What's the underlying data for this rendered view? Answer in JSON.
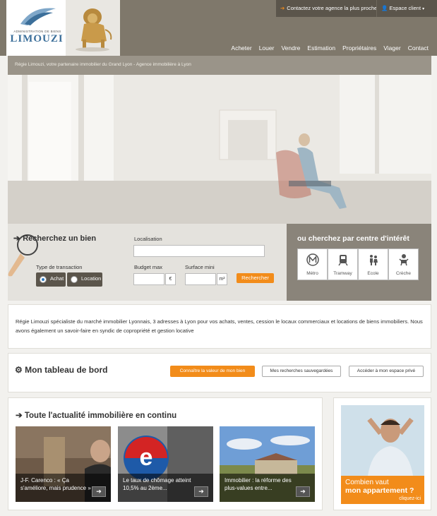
{
  "colors": {
    "accent": "#f28c1a",
    "header": "#7f786b",
    "brand_blue": "#3c6f9a"
  },
  "logo": {
    "subtitle": "ADMINISTRATION DE BIENS",
    "name": "LIMOUZI"
  },
  "topbar": {
    "contact": "Contactez votre agence la plus proche",
    "client": "Espace client"
  },
  "nav": [
    "Acheter",
    "Louer",
    "Vendre",
    "Estimation",
    "Propriétaires",
    "Viager",
    "Contact"
  ],
  "tagline": "Régie Limouzi, votre partenaire immobilier du Grand Lyon - Agence immobilière à Lyon",
  "search": {
    "title": "Recherchez un bien",
    "localisation_label": "Localisation",
    "localisation_value": "",
    "transaction_label": "Type de transaction",
    "achat": "Achat",
    "location": "Location",
    "budget_label": "Budget max",
    "budget_unit": "€",
    "surface_label": "Surface mini",
    "surface_unit": "m²",
    "submit": "Rechercher"
  },
  "poi": {
    "title": "ou cherchez par centre d'intérêt",
    "items": [
      {
        "label": "Métro",
        "icon": "metro-icon"
      },
      {
        "label": "Tramway",
        "icon": "tram-icon"
      },
      {
        "label": "Ecole",
        "icon": "school-icon"
      },
      {
        "label": "Crèche",
        "icon": "nursery-icon"
      }
    ]
  },
  "description": "Régie Limouzi spécialiste du marché immobilier Lyonnais, 3 adresses à Lyon pour vos achats, ventes, cession le locaux commerciaux et locations de biens immobiliers. Nous avons également un savoir-faire en syndic de copropriété et gestion locative",
  "dashboard": {
    "title": "Mon tableau de bord",
    "btn_value": "Connaître la valeur de mon bien",
    "btn_saved": "Mes recherches sauvegardées",
    "btn_private": "Accéder à mon espace privé"
  },
  "news": {
    "title": "Toute l'actualité immobilière en continu",
    "items": [
      {
        "caption": "J-F. Carenco : « Ça s'améliore, mais prudence »"
      },
      {
        "caption": "Le taux de chômage atteint 10,5% au 2ème..."
      },
      {
        "caption": "Immobilier : la réforme des plus-values entre..."
      }
    ]
  },
  "promo": {
    "line1": "Combien vaut",
    "line2": "mon appartement ?",
    "cta": "cliquez-ici"
  }
}
